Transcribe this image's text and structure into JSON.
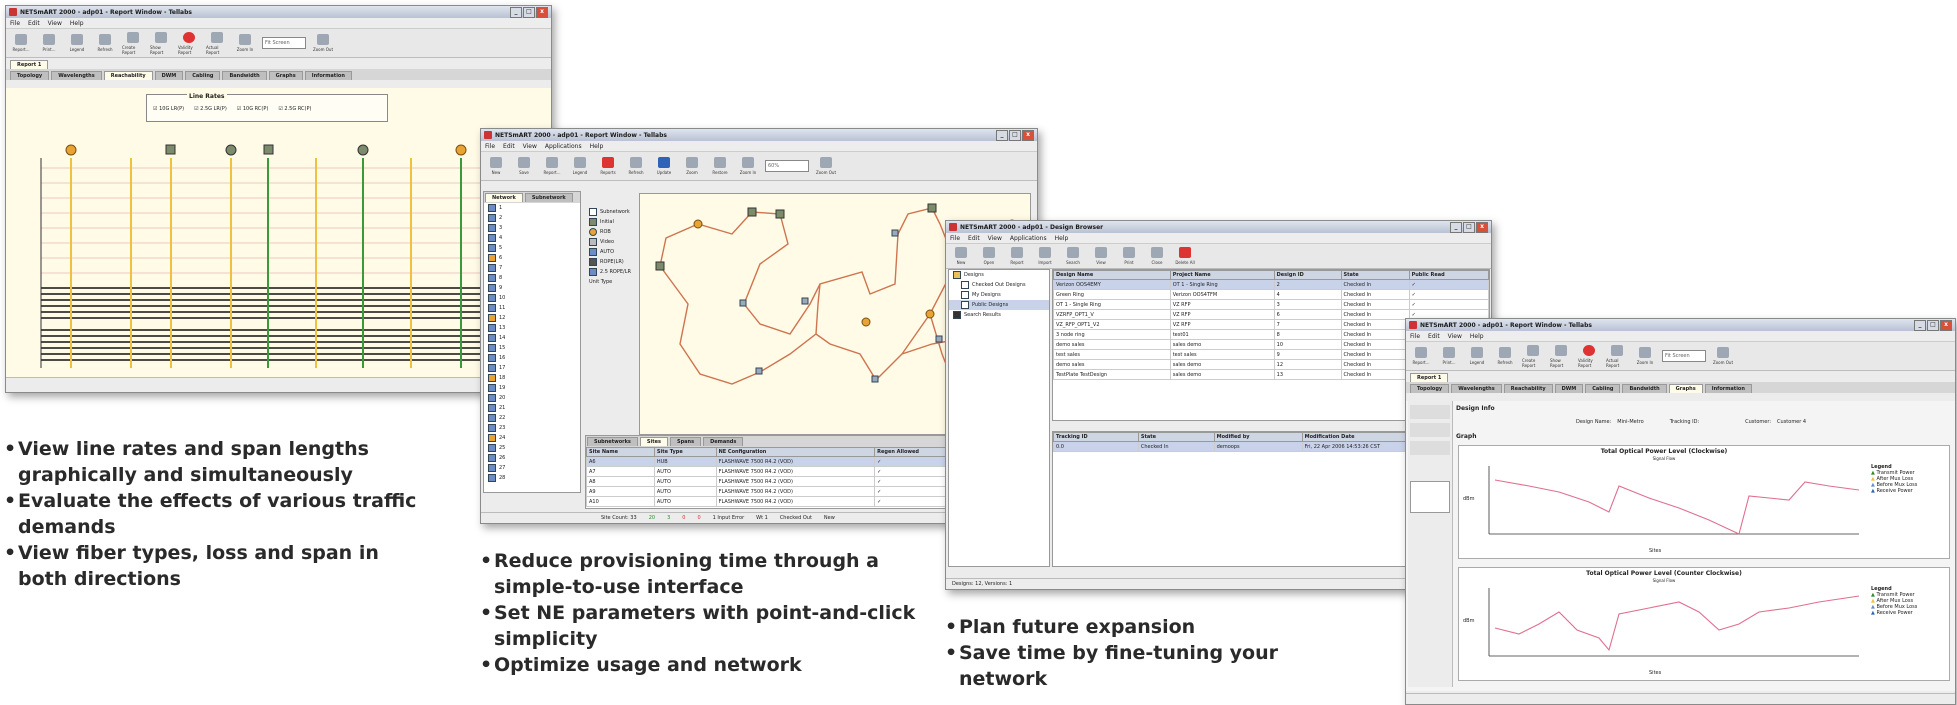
{
  "win1": {
    "title": "NETSmART 2000 - adp01 - Report Window - Tellabs",
    "menu": [
      "File",
      "Edit",
      "View",
      "Help"
    ],
    "toolbar": [
      "Report...",
      "Print...",
      "Legend",
      "Refresh",
      "Create Report",
      "Show Report",
      "Validity Report",
      "Actual Report",
      "Zoom In",
      "Zoom Out"
    ],
    "zoom_value": "Fit Screen",
    "report_tab": "Report 1",
    "tabs": [
      "Topology",
      "Wavelengths",
      "Reachability",
      "DWM",
      "Cabling",
      "Bandwidth",
      "Graphs",
      "Information"
    ],
    "active_tab": "Reachability",
    "line_rates_title": "Line Rates",
    "line_rates": [
      "10G LR(P)",
      "2.5G LR(P)",
      "10G RC(P)",
      "2.5G RC(P)"
    ]
  },
  "win2": {
    "title": "NETSmART 2000 - adp01 - Report Window - Tellabs",
    "menu": [
      "File",
      "Edit",
      "View",
      "Applications",
      "Help"
    ],
    "toolbar": [
      "New",
      "Save",
      "Report...",
      "Legend",
      "Reports",
      "Refresh",
      "Update",
      "Zoom",
      "Restore",
      "Zoom In",
      "Zoom Out"
    ],
    "zoom_value": "60%",
    "left_tabs": [
      "Network",
      "Subnetwork"
    ],
    "legend": [
      "Subnetwork",
      "Initial",
      "ROB",
      "Video",
      "AUTO",
      "ROPE(LR)",
      "2.5 ROPE/LR",
      "Unit Type"
    ],
    "bottom_tabs": [
      "Subnetworks",
      "Sites",
      "Spans",
      "Demands"
    ],
    "table_headers": [
      "Site Name",
      "Site Type",
      "NE Configuration",
      "Regen Allowed",
      "MUX Type"
    ],
    "table_rows": [
      [
        "A6",
        "HUB",
        "FLASHWAVE 7500 R4.2 (VOD)",
        "✓",
        ""
      ],
      [
        "A7",
        "AUTO",
        "FLASHWAVE 7500 R4.2 (VOD)",
        "✓",
        ""
      ],
      [
        "A8",
        "AUTO",
        "FLASHWAVE 7500 R4.2 (VOD)",
        "✓",
        ""
      ],
      [
        "A9",
        "AUTO",
        "FLASHWAVE 7500 R4.2 (VOD)",
        "✓",
        ""
      ],
      [
        "A10",
        "AUTO",
        "FLASHWAVE 7500 R4.2 (VOD)",
        "✓",
        ""
      ]
    ],
    "status": [
      "Site Count: 33",
      "20",
      "3",
      "0",
      "0",
      "1 Input Error",
      "Wt 1",
      "Checked Out",
      "New"
    ]
  },
  "win3": {
    "title": "NETSmART 2000 - adp01 - Design Browser",
    "menu": [
      "File",
      "Edit",
      "View",
      "Applications",
      "Help"
    ],
    "toolbar": [
      "New",
      "Open",
      "Report",
      "Import",
      "Search",
      "View",
      "Print",
      "Close",
      "Delete All"
    ],
    "tree": [
      "Designs",
      "Checked Out Designs",
      "My Designs",
      "Public Designs",
      "Search Results"
    ],
    "headers": [
      "Design Name",
      "Project Name",
      "Design ID",
      "State",
      "Public Read"
    ],
    "rows": [
      [
        "Verizon OOS4EMY",
        "OT 1 - Single Ring",
        "2",
        "Checked In",
        "✓"
      ],
      [
        "Green Ring",
        "Verizon OOS4TFM",
        "4",
        "Checked In",
        "✓"
      ],
      [
        "OT 1 - Single Ring",
        "VZ RFP",
        "3",
        "Checked In",
        "✓"
      ],
      [
        "VZRFP_OPT1_V",
        "VZ RFP",
        "6",
        "Checked In",
        "✓"
      ],
      [
        "VZ_RFP_OPT1_V2",
        "VZ RFP",
        "7",
        "Checked In",
        "✓"
      ],
      [
        "3 node ring",
        "test01",
        "8",
        "Checked In",
        "✓"
      ],
      [
        "demo sales",
        "sales demo",
        "10",
        "Checked In",
        "✓"
      ],
      [
        "test sales",
        "test sales",
        "9",
        "Checked In",
        "✓"
      ],
      [
        "demo sales",
        "sales demo",
        "12",
        "Checked In",
        "✓"
      ],
      [
        "TestPlate TestDesign",
        "sales demo",
        "13",
        "Checked In",
        "✓"
      ]
    ],
    "sub_headers": [
      "Tracking ID",
      "State",
      "Modified by",
      "Modification Date"
    ],
    "sub_row": [
      "0.0",
      "Checked In",
      "demoops",
      "Fri, 22 Apr 2006 14:53:26 CST"
    ],
    "status": "Designs: 12, Versions: 1"
  },
  "win4": {
    "title": "NETSmART 2000 - adp01 - Report Window - Tellabs",
    "menu": [
      "File",
      "Edit",
      "View",
      "Help"
    ],
    "toolbar": [
      "Report...",
      "Print...",
      "Legend",
      "Refresh",
      "Create Report",
      "Show Report",
      "Validity Report",
      "Actual Report",
      "Zoom In",
      "Zoom Out"
    ],
    "zoom_value": "Fit Screen",
    "report_tab": "Report 1",
    "tabs": [
      "Topology",
      "Wavelengths",
      "Reachability",
      "DWM",
      "Cabling",
      "Bandwidth",
      "Graphs",
      "Information"
    ],
    "active_tab": "Graphs",
    "design_info": "Design Info",
    "design_name_label": "Design Name:",
    "design_name_value": "Mini-Metro",
    "tracking_label": "Tracking ID:",
    "customer_label": "Customer:",
    "customer_value": "Customer 4",
    "graph_label": "Graph",
    "chart1_title": "Total Optical Power Level (Clockwise)",
    "chart1_subtitle": "Signal Flow",
    "chart2_title": "Total Optical Power Level (Counter Clockwise)",
    "chart2_subtitle": "Signal Flow",
    "legend_title": "Legend",
    "legend": [
      "Transmit Power",
      "After Mux Loss",
      "Before Mux Loss",
      "Receive Power"
    ],
    "ylabel": "dBm",
    "xlabel": "Sites"
  },
  "bullets1": [
    "View line rates and span lengths graphically and simultaneously",
    "Evaluate the effects of various traffic demands",
    "View fiber types, loss and span in both directions"
  ],
  "bullets2": [
    "Reduce provisioning time through a simple-to-use interface",
    "Set NE parameters with point-and-click simplicity",
    "Optimize usage and network"
  ],
  "bullets3": [
    "Plan future expansion",
    "Save time by fine-tuning your network"
  ]
}
